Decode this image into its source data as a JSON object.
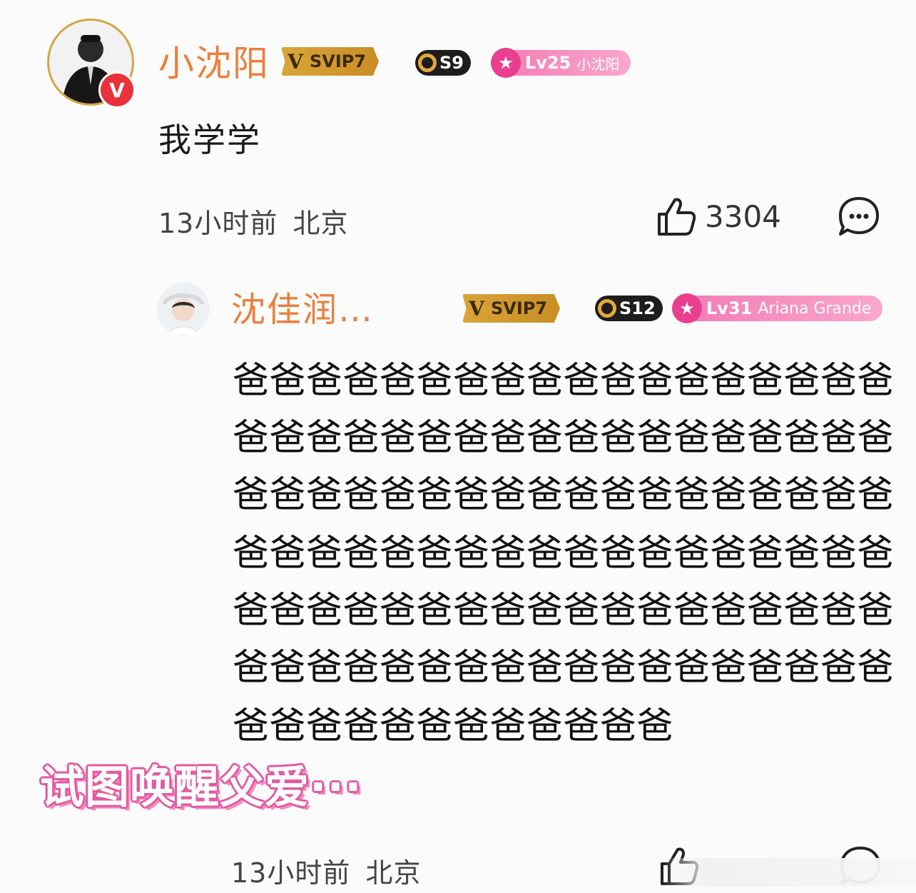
{
  "comment1": {
    "username": "小沈阳",
    "svip": "SVIP7",
    "season": "S9",
    "level": "Lv25",
    "level_tag": "小沈阳",
    "verified": "V",
    "text": "我学学",
    "time": "13小时前",
    "location": "北京",
    "likes": "3304"
  },
  "reply": {
    "username": "沈佳润…",
    "svip": "SVIP7",
    "season": "S12",
    "level": "Lv31",
    "level_tag": "Ariana Grande",
    "lines": [
      "爸爸爸爸爸爸爸爸爸爸爸爸爸爸爸爸爸爸",
      "爸爸爸爸爸爸爸爸爸爸爸爸爸爸爸爸爸爸",
      "爸爸爸爸爸爸爸爸爸爸爸爸爸爸爸爸爸爸",
      "爸爸爸爸爸爸爸爸爸爸爸爸爸爸爸爸爸爸",
      "爸爸爸爸爸爸爸爸爸爸爸爸爸爸爸爸爸爸",
      "爸爸爸爸爸爸爸爸爸爸爸爸爸爸爸爸爸爸",
      "爸爸爸爸爸爸爸爸爸爸爸爸"
    ],
    "time": "13小时前",
    "location": "北京"
  },
  "overlay_caption": "试图唤醒父爱···",
  "colors": {
    "username": "#ec7f3c",
    "verified": "#e8323c",
    "svip_gold": "#d9a53a",
    "level_pink": "#f27bb4"
  },
  "icons": {
    "like": "thumbs-up-icon",
    "comment": "comment-bubble-icon"
  }
}
